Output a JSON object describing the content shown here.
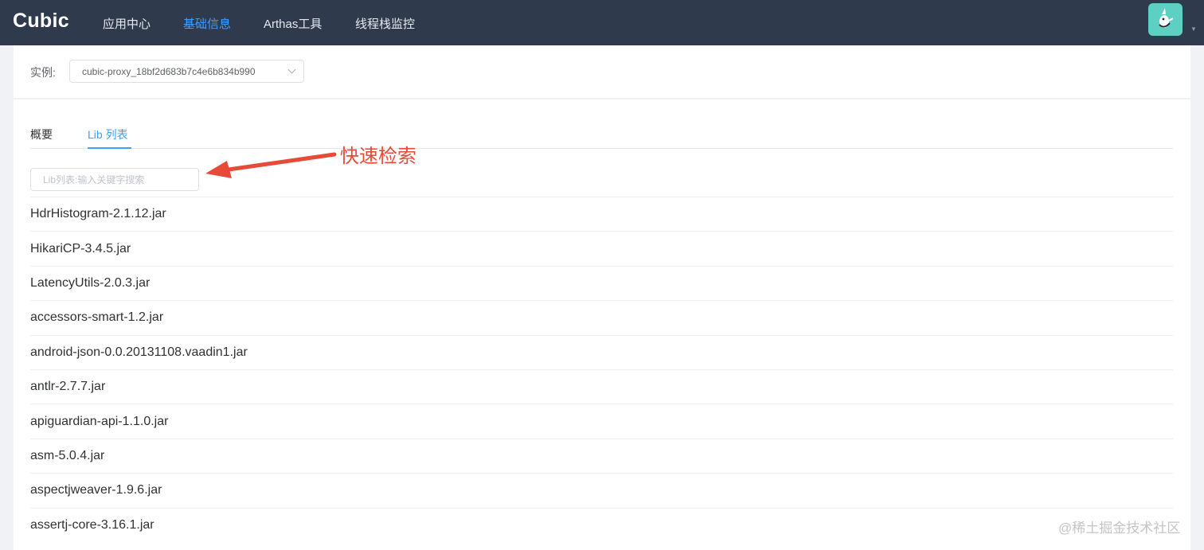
{
  "app": {
    "title": "Cubic"
  },
  "nav": {
    "items": [
      {
        "label": "应用中心"
      },
      {
        "label": "基础信息"
      },
      {
        "label": "Arthas工具"
      },
      {
        "label": "线程栈监控"
      }
    ],
    "active_index": 1,
    "active_color": "#409eff"
  },
  "user": {
    "avatar_icon": "avatar-icon",
    "avatar_bg": "#5ecfc3"
  },
  "instance": {
    "label": "实例:",
    "selected_value": "cubic-proxy_18bf2d683b7c4e6b834b990"
  },
  "tabs": {
    "items": [
      {
        "label": "概要"
      },
      {
        "label": "Lib 列表"
      }
    ],
    "active_index": 1
  },
  "search": {
    "placeholder": "Lib列表:输入关键字搜索",
    "value": ""
  },
  "annotation": {
    "text": "快速检索",
    "color": "#e84a3a"
  },
  "libs": [
    "HdrHistogram-2.1.12.jar",
    "HikariCP-3.4.5.jar",
    "LatencyUtils-2.0.3.jar",
    "accessors-smart-1.2.jar",
    "android-json-0.0.20131108.vaadin1.jar",
    "antlr-2.7.7.jar",
    "apiguardian-api-1.1.0.jar",
    "asm-5.0.4.jar",
    "aspectjweaver-1.9.6.jar",
    "assertj-core-3.16.1.jar"
  ],
  "watermark": "@稀土掘金技术社区"
}
